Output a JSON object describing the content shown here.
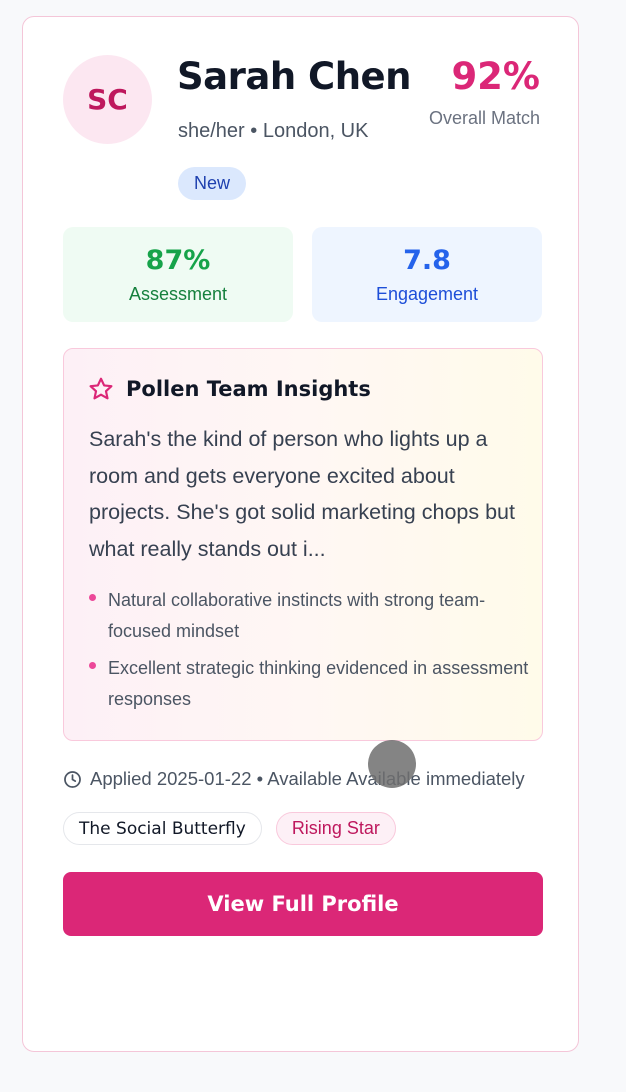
{
  "candidate": {
    "initials": "SC",
    "name": "Sarah Chen",
    "meta": "she/her • London, UK",
    "badge": "New",
    "match_value": "92%",
    "match_label": "Overall Match"
  },
  "stats": {
    "assessment_value": "87%",
    "assessment_label": "Assessment",
    "engagement_value": "7.8",
    "engagement_label": "Engagement"
  },
  "insights": {
    "title": "Pollen Team Insights",
    "icon": "star-icon",
    "summary": "Sarah's the kind of person who lights up a room and gets everyone excited about projects. She's got solid marketing chops but what really stands out i...",
    "highlights": [
      "Natural collaborative instincts with strong team-focused mindset",
      "Excellent strategic thinking evidenced in assessment responses"
    ]
  },
  "availability": {
    "icon": "clock-icon",
    "text": "Applied 2025-01-22 • Available Available immediately"
  },
  "tags": [
    "The Social Butterfly",
    "Rising Star"
  ],
  "cta_label": "View Full Profile",
  "colors": {
    "accent": "#db2777",
    "assessment": "#16a34a",
    "engagement": "#2563eb"
  }
}
